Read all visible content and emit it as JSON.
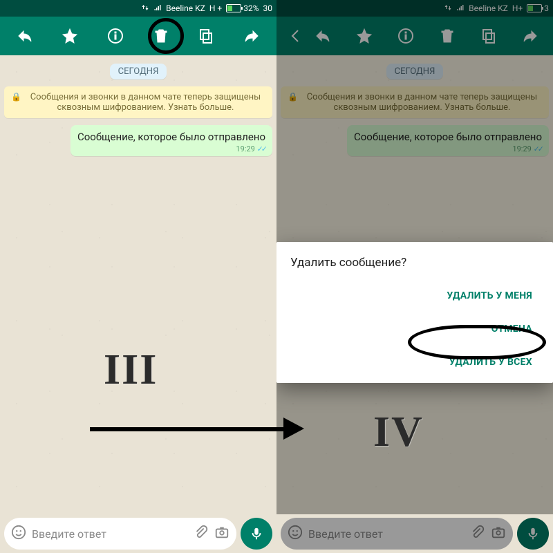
{
  "statusbar": {
    "carrier": "Beeline KZ",
    "network": "H +",
    "battery_pct": "32%",
    "time_fragment_left": "30",
    "time_fragment_right": "3"
  },
  "appbar_icons": {
    "reply": "reply",
    "star": "star",
    "info": "info",
    "delete": "delete",
    "copy": "copy",
    "forward": "forward",
    "back": "back"
  },
  "chat": {
    "date_chip": "СЕГОДНЯ",
    "encryption_banner": "Сообщения и звонки в данном чате теперь защищены сквозным шифрованием. Узнать больше.",
    "message_text": "Сообщение, которое было отправлено",
    "message_time": "19:29",
    "input_placeholder": "Введите ответ"
  },
  "dialog": {
    "title": "Удалить сообщение?",
    "delete_for_me": "УДАЛИТЬ У МЕНЯ",
    "cancel": "ОТМЕНА",
    "delete_for_all": "УДАЛИТЬ У ВСЕХ"
  },
  "labels": {
    "left_roman": "III",
    "right_roman": "IV"
  },
  "colors": {
    "appbar": "#008069",
    "statusbar": "#004d40",
    "bubble_out": "#d9fdd3",
    "banner": "#fff5c4",
    "accent": "#008069"
  }
}
